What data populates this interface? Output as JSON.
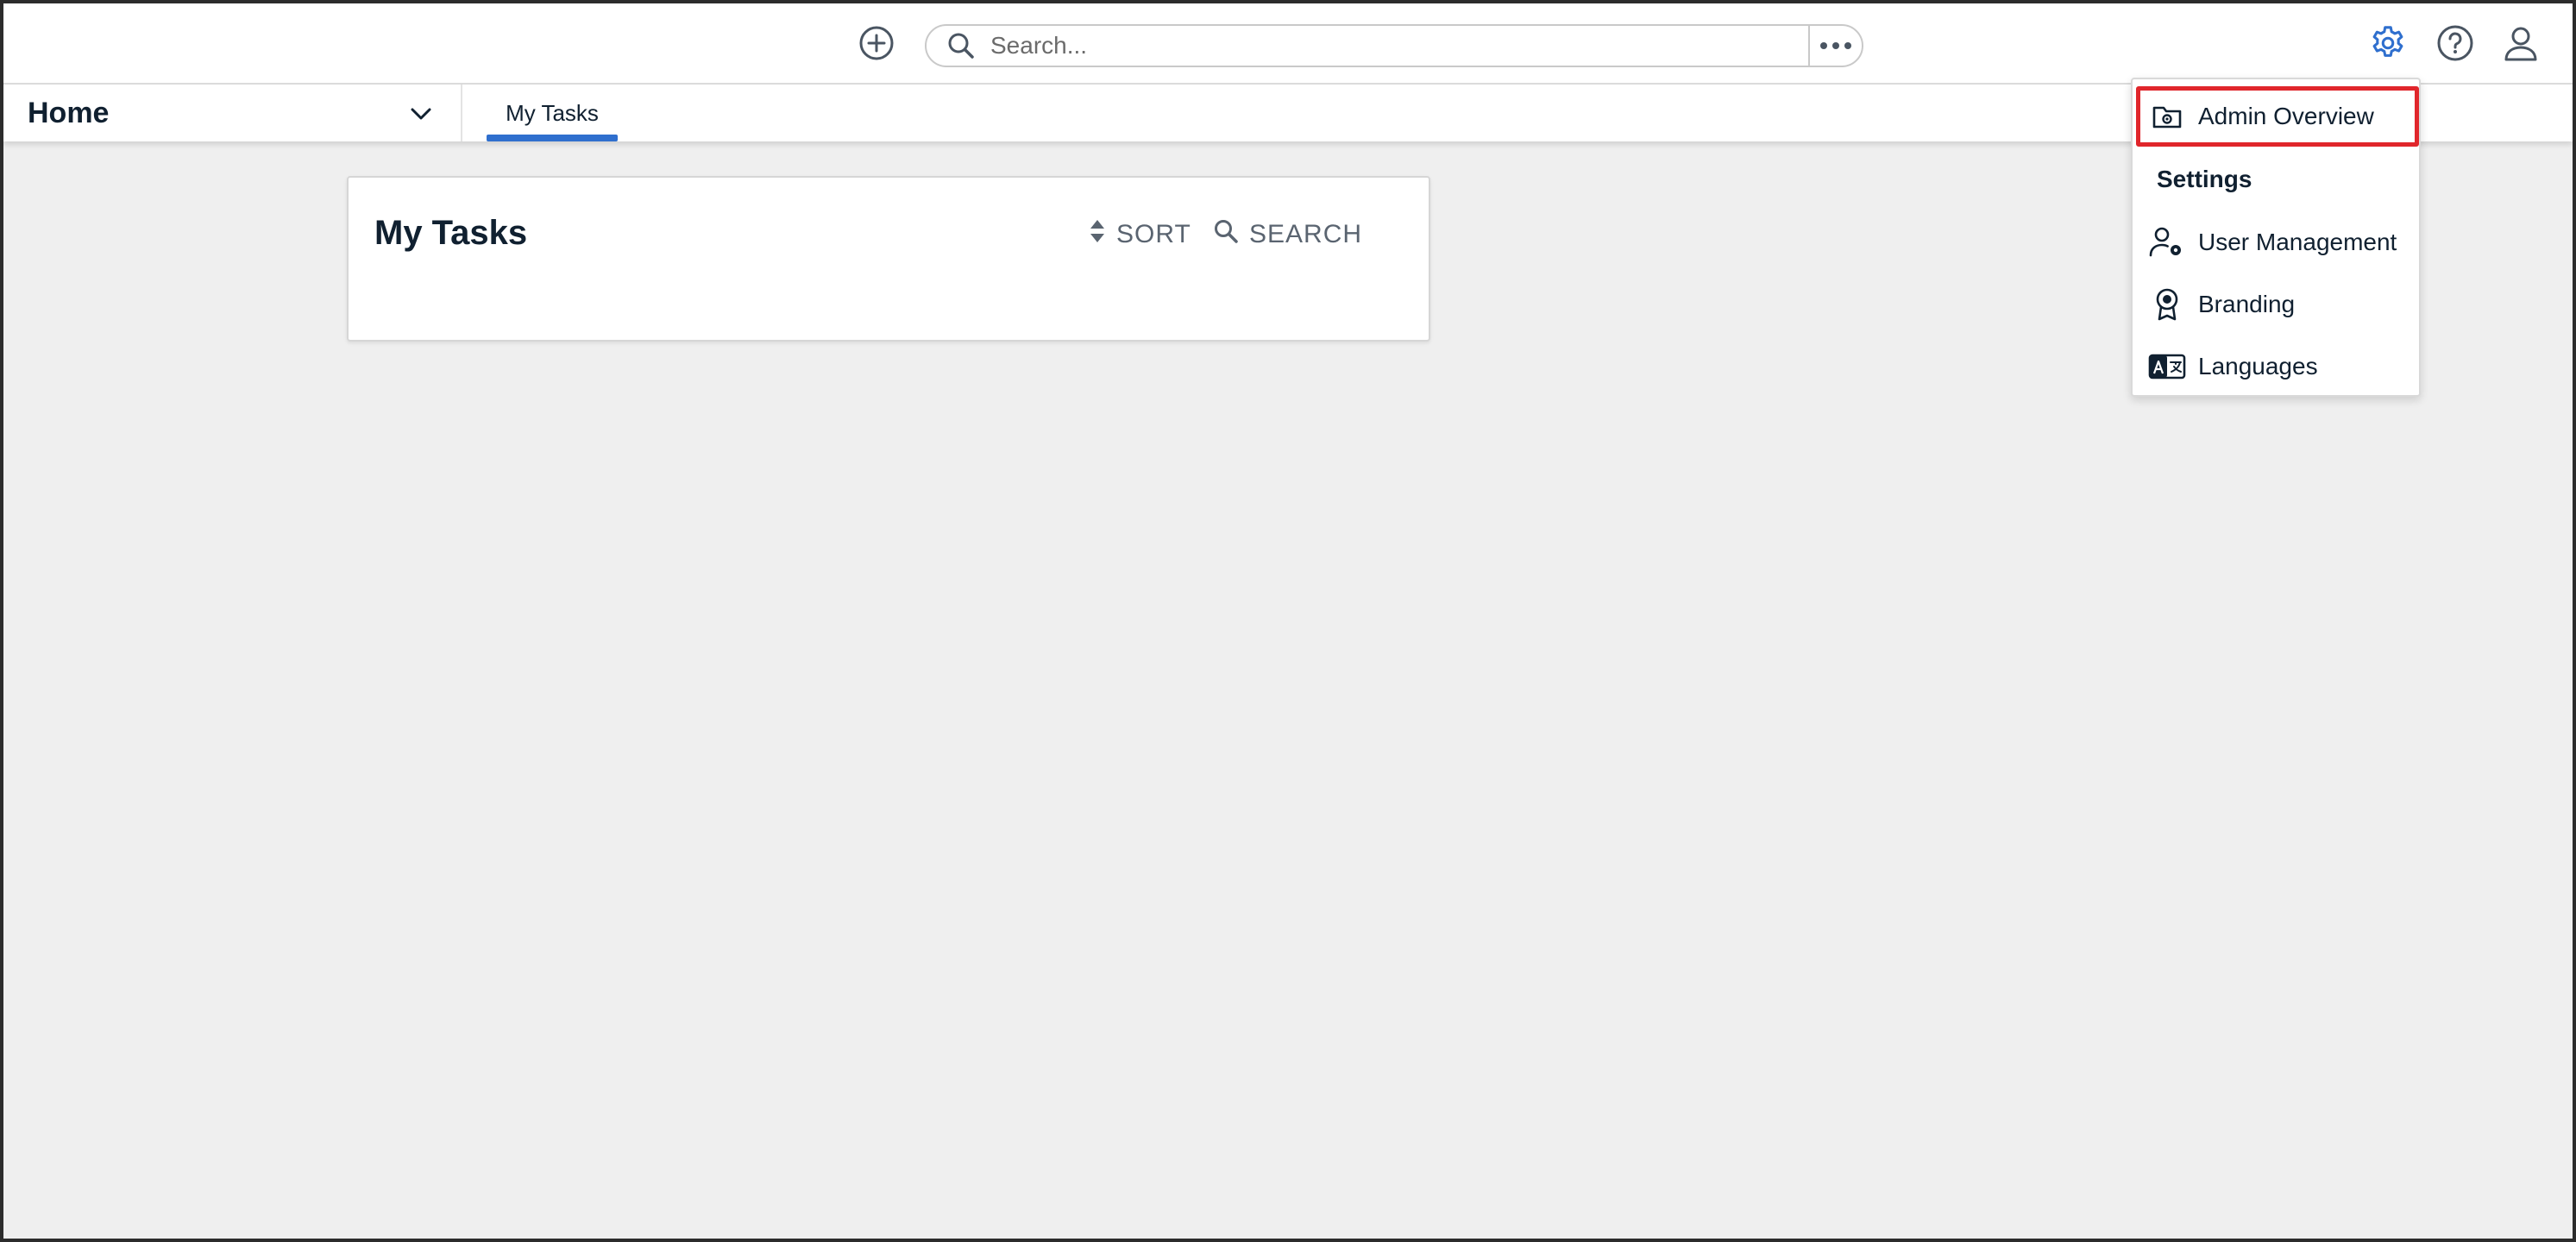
{
  "topbar": {
    "search_placeholder": "Search...",
    "icons": {
      "add": "plus-circle-icon",
      "search": "search-icon",
      "more": "more-horizontal-icon",
      "settings": "gear-icon",
      "help": "help-circle-icon",
      "profile": "user-icon"
    },
    "settings_color": "#2f6fce"
  },
  "navbar": {
    "home_label": "Home",
    "tabs": [
      {
        "label": "My Tasks",
        "active": true
      }
    ],
    "accent_color": "#2f6fce"
  },
  "card": {
    "title": "My Tasks",
    "sort_label": "SORT",
    "search_label": "SEARCH"
  },
  "dropdown": {
    "admin_overview": "Admin Overview",
    "settings_heading": "Settings",
    "items": [
      {
        "label": "User Management",
        "icon": "user-gear-icon"
      },
      {
        "label": "Branding",
        "icon": "award-icon"
      },
      {
        "label": "Languages",
        "icon": "translate-icon"
      }
    ],
    "highlight_color": "#e0262b"
  }
}
